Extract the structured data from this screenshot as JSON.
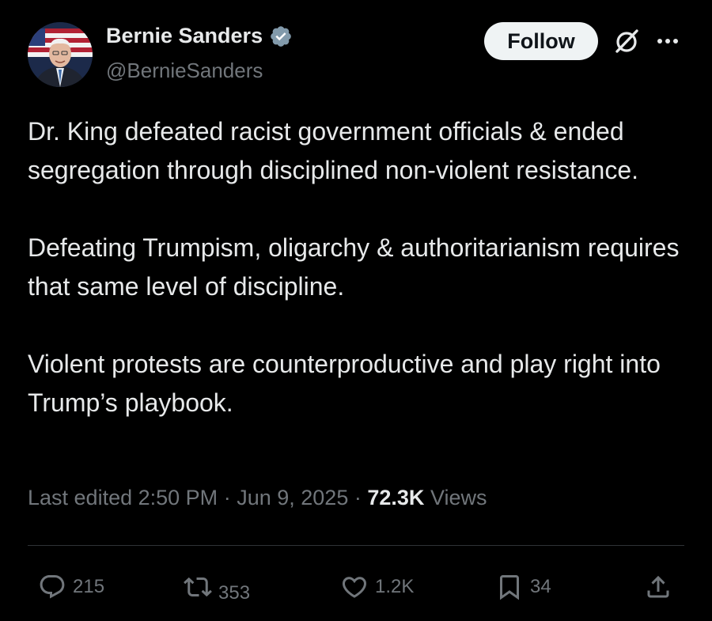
{
  "author": {
    "name": "Bernie Sanders",
    "handle": "@BernieSanders",
    "verified_icon": "verified-badge-icon",
    "accent": "#1d9bf0"
  },
  "header": {
    "follow_label": "Follow",
    "grok_icon": "grok-icon",
    "more_icon": "more-icon"
  },
  "tweet": {
    "paragraphs": [
      "Dr. King defeated racist government officials & ended segregation through disciplined non-violent resistance.",
      "Defeating Trumpism, oligarchy & authoritarianism requires that same level of discipline.",
      "Violent protests are counterproductive and play right into Trump’s playbook."
    ]
  },
  "meta": {
    "edited_label": "Last edited",
    "time": "2:50 PM",
    "separator": "·",
    "date": "Jun 9, 2025",
    "views_count": "72.3K",
    "views_label": "Views"
  },
  "actions": {
    "replies": "215",
    "reposts": "353",
    "likes": "1.2K",
    "bookmarks": "34"
  },
  "colors": {
    "background": "#000000",
    "text": "#e7e9ea",
    "secondary": "#71767b",
    "divider": "#2f3336",
    "follow_bg": "#eff3f4"
  }
}
